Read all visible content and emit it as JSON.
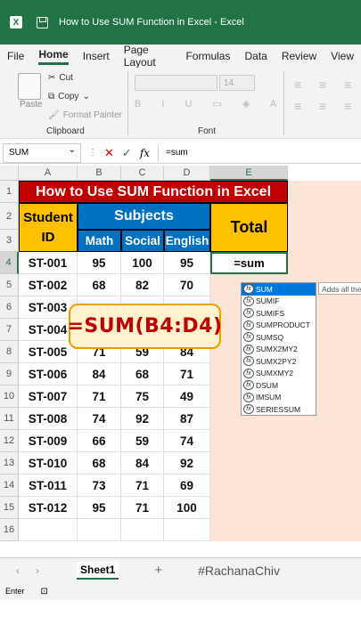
{
  "titlebar": {
    "app_icon": "excel-icon",
    "title": "How to Use SUM Function in Excel  -  Excel"
  },
  "menu": [
    "File",
    "Home",
    "Insert",
    "Page Layout",
    "Formulas",
    "Data",
    "Review",
    "View"
  ],
  "ribbon": {
    "paste": "Paste",
    "cut": "Cut",
    "copy": "Copy",
    "format_painter": "Format Painter",
    "clipboard_group": "Clipboard",
    "font_size": "14",
    "font_group": "Font"
  },
  "formula_bar": {
    "name_box": "SUM",
    "fx": "fx",
    "formula": "=sum"
  },
  "columns": [
    "A",
    "B",
    "C",
    "D",
    "E"
  ],
  "rows": [
    "1",
    "2",
    "3",
    "4",
    "5",
    "6",
    "7",
    "8",
    "9",
    "10",
    "11",
    "12",
    "13",
    "14",
    "15",
    "16"
  ],
  "sheet": {
    "title": "How to Use SUM Function in Excel",
    "student_id": "Student\nID",
    "subjects": "Subjects",
    "total": "Total",
    "subject_names": [
      "Math",
      "Social",
      "English"
    ],
    "records": [
      {
        "id": "ST-001",
        "math": "95",
        "social": "100",
        "english": "95"
      },
      {
        "id": "ST-002",
        "math": "68",
        "social": "82",
        "english": "70"
      },
      {
        "id": "ST-003",
        "math": "",
        "social": "",
        "english": ""
      },
      {
        "id": "ST-004",
        "math": "",
        "social": "",
        "english": ""
      },
      {
        "id": "ST-005",
        "math": "71",
        "social": "59",
        "english": "84"
      },
      {
        "id": "ST-006",
        "math": "84",
        "social": "68",
        "english": "71"
      },
      {
        "id": "ST-007",
        "math": "71",
        "social": "75",
        "english": "49"
      },
      {
        "id": "ST-008",
        "math": "74",
        "social": "92",
        "english": "87"
      },
      {
        "id": "ST-009",
        "math": "66",
        "social": "59",
        "english": "74"
      },
      {
        "id": "ST-010",
        "math": "68",
        "social": "84",
        "english": "92"
      },
      {
        "id": "ST-011",
        "math": "73",
        "social": "71",
        "english": "69"
      },
      {
        "id": "ST-012",
        "math": "95",
        "social": "71",
        "english": "100"
      }
    ],
    "active_input": "=sum"
  },
  "autocomplete": [
    "SUM",
    "SUMIF",
    "SUMIFS",
    "SUMPRODUCT",
    "SUMSQ",
    "SUMX2MY2",
    "SUMX2PY2",
    "SUMXMY2",
    "DSUM",
    "IMSUM",
    "SERIESSUM"
  ],
  "tooltip": "Adds all the",
  "overlay": "=SUM(B4:D4)",
  "sheet_tab": "Sheet1",
  "watermark": "#RachanaChiv",
  "status": "Enter",
  "colors": {
    "excel_green": "#217346",
    "title_red": "#c00000",
    "header_yellow": "#ffc000",
    "header_blue": "#0070c0",
    "total_bg": "#fce4d6"
  }
}
